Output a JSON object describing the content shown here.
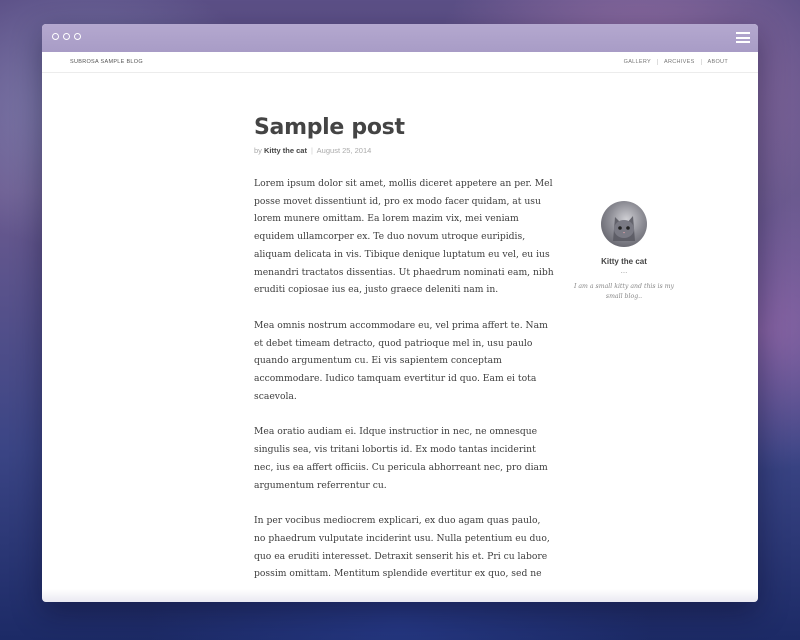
{
  "blog": {
    "site_name": "SUBROSA SAMPLE BLOG",
    "nav": [
      "GALLERY",
      "ARCHIVES",
      "ABOUT"
    ]
  },
  "post": {
    "title": "Sample post",
    "by_label": "by",
    "author": "Kitty the cat",
    "date": "August 25, 2014",
    "paragraphs": [
      "Lorem ipsum dolor sit amet, mollis diceret appetere an per. Mel posse movet dissentiunt id, pro ex modo facer quidam, at usu lorem munere omittam. Ea lorem mazim vix, mei veniam equidem ullamcorper ex. Te duo novum utroque euripidis, aliquam delicata in vis. Tibique denique luptatum eu vel, eu ius menandri tractatos dissentias. Ut phaedrum nominati eam, nibh eruditi copiosae ius ea, justo graece deleniti nam in.",
      "Mea omnis nostrum accommodare eu, vel prima affert te. Nam et debet timeam detracto, quod patrioque mel in, usu paulo quando argumentum cu. Ei vis sapientem conceptam accommodare. Iudico tamquam evertitur id quo. Eam ei tota scaevola.",
      "Mea oratio audiam ei. Idque instructior in nec, ne omnesque singulis sea, vis tritani lobortis id. Ex modo tantas inciderint nec, ius ea affert officiis. Cu pericula abhorreant nec, pro diam argumentum referrentur cu.",
      "In per vocibus mediocrem explicari, ex duo agam quas paulo, no phaedrum vulputate inciderint usu. Nulla petentium eu duo, quo ea eruditi interesset. Detraxit senserit his et. Pri cu labore possim omittam. Mentitum splendide evertitur ex quo, sed ne"
    ]
  },
  "sidebar": {
    "name": "Kitty the cat",
    "ellipsis": "...",
    "description": "I am a small kitty and this is my small blog.."
  },
  "icons": {
    "window_controls": "three-circle-icons",
    "menu": "hamburger-menu-icon"
  }
}
